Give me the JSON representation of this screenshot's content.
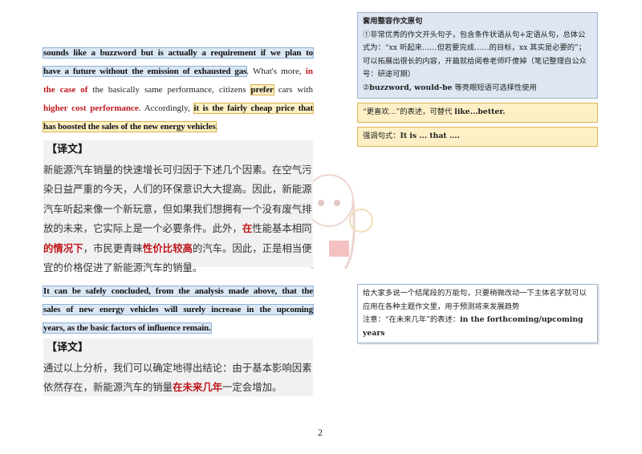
{
  "paragraph1": {
    "l1": "sounds like a buzzword but is actually a requirement if we plan to",
    "l2a": "have a future without the emission of exhausted gas",
    "l2b": ". What's more, ",
    "l2c": "in",
    "l3a": "the case of",
    "l3b": " the basically same performance, citizens ",
    "l3c": "prefer",
    "l3d": " cars with",
    "l4a": "higher cost performance",
    "l4b": ". Accordingly, ",
    "l4c": "it is the fairly cheap price that",
    "l5a": "has boosted the sales of the new energy vehicles",
    "l5b": "."
  },
  "translation1": {
    "heading": "【译文】",
    "t1": "新能源汽车销量的快速增长可归因于下述几个因素。在空气污染日益严重的今天，人们的环保意识大大提高。因此，新能源汽车听起来像一个新玩意，但如果我们想拥有一个没有废气排放的未来，它实际上是一个必要条件。此外，",
    "t2": "在",
    "t3": "性能基本相同",
    "t4": "的情况下",
    "t5": "，市民更青睐",
    "t6": "性价比较高",
    "t7": "的汽车。因此，正是相当便宜的价格促进了新能源汽车的销量。"
  },
  "paragraph2": {
    "l1": "It can be safely concluded, from the analysis made above, that the",
    "l2": "sales of new energy vehicles will surely increase in the upcoming",
    "l3": "years, as the basic factors of influence remain."
  },
  "translation2": {
    "heading": "【译文】",
    "t1": "通过以上分析，我们可以确定地得出结论：由于基本影响因素依然存在，新能源汽车的销量",
    "t2": "在未来几年",
    "t3": "一定会增加。"
  },
  "notes": [
    {
      "title": "套用整容作文原句",
      "l1": "①非常优秀的作文开头句子，包含条件状语从句+定语从句，总体公式为：“xx 听起来……但若要完成……的目标，xx 其实是必要的”；可以拓展出很长的内容，开篇就给阅卷老师吓傻掉（笔记整理自公众号：研途可期）",
      "l2a": "②",
      "l2b": "buzzword, would-be",
      "l2c": " 等亮眼短语可选择性使用"
    },
    {
      "a": "“更喜欢...”的表述，可替代 ",
      "b": "like...better."
    },
    {
      "a": "强调句式：",
      "b": "It is ... that ...."
    },
    {
      "l1": "给大家多说一个结尾段的万能句，只要稍微改动一下主体名字就可以应用在各种主题作文里，用于预测将来发展趋势",
      "l2a": "注意：“在未来几年”的表述：",
      "l2b": "in the forthcoming/upcoming years"
    }
  ],
  "watermark_logo": "研途可期",
  "page_number": "2"
}
